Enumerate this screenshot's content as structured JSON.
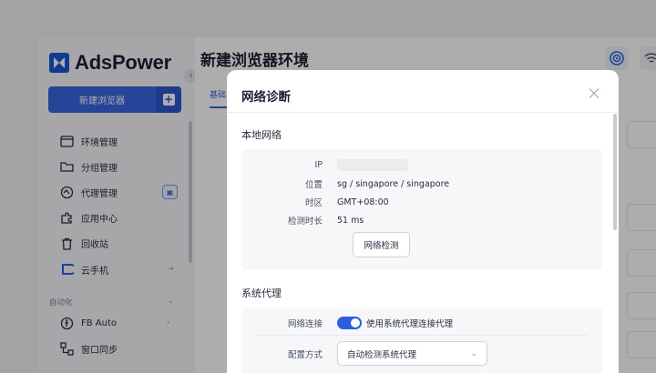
{
  "app": {
    "brand": "AdsPower",
    "page_title": "新建浏览器环境",
    "tab_peek": "基础"
  },
  "sidebar": {
    "new_button": "新建浏览器",
    "items": [
      {
        "label": "环境管理",
        "icon": "window-icon"
      },
      {
        "label": "分组管理",
        "icon": "folder-icon"
      },
      {
        "label": "代理管理",
        "icon": "proxy-icon"
      },
      {
        "label": "应用中心",
        "icon": "puzzle-icon"
      },
      {
        "label": "回收站",
        "icon": "trash-icon"
      },
      {
        "label": "云手机",
        "icon": "cloud-phone-icon"
      }
    ],
    "section_label": "自动化",
    "automation_items": [
      {
        "label": "FB Auto",
        "icon": "fb-auto-icon"
      },
      {
        "label": "窗口同步",
        "icon": "sync-icon"
      }
    ]
  },
  "modal": {
    "title": "网络诊断",
    "local_network": {
      "heading": "本地网络",
      "ip_label": "IP",
      "location_label": "位置",
      "location_value": "sg / singapore / singapore",
      "timezone_label": "时区",
      "timezone_value": "GMT+08:00",
      "duration_label": "检测时长",
      "duration_value": "51 ms",
      "check_button": "网络检测"
    },
    "system_proxy": {
      "heading": "系统代理",
      "connection_label": "网络连接",
      "toggle_text": "使用系统代理连接代理",
      "toggle_on": true,
      "config_label": "配置方式",
      "config_value": "自动检测系统代理"
    }
  },
  "colors": {
    "accent": "#3a66e0",
    "overlay": "rgba(0,0,0,0.32)"
  }
}
